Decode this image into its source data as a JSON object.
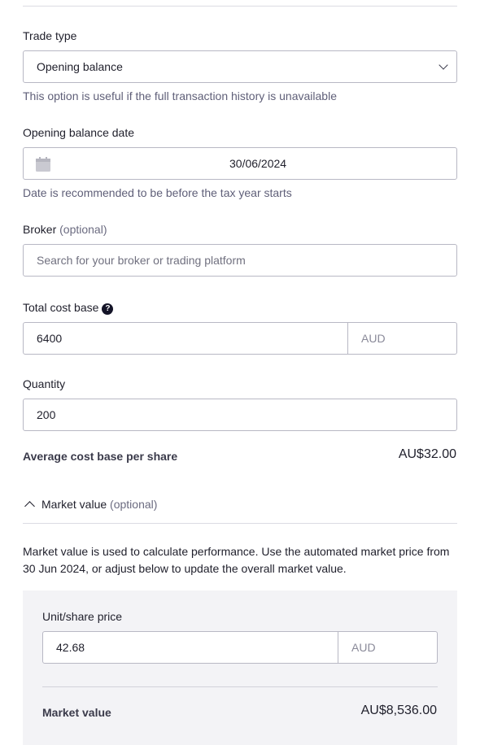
{
  "trade_type": {
    "label": "Trade type",
    "selected": "Opening balance",
    "hint": "This option is useful if the full transaction history is unavailable"
  },
  "opening_date": {
    "label": "Opening balance date",
    "value": "30/06/2024",
    "hint": "Date is recommended to be before the tax year starts"
  },
  "broker": {
    "label": "Broker",
    "optional": "(optional)",
    "placeholder": "Search for your broker or trading platform"
  },
  "total_cost": {
    "label": "Total cost base",
    "value": "6400",
    "currency": "AUD"
  },
  "quantity": {
    "label": "Quantity",
    "value": "200"
  },
  "average_cost": {
    "label": "Average cost base per share",
    "value": "AU$32.00"
  },
  "market_value_section": {
    "toggle_label": "Market value",
    "optional": "(optional)",
    "description": "Market value is used to calculate performance. Use the automated market price from 30 Jun 2024, or adjust below to update the overall market value.",
    "unit_price_label": "Unit/share price",
    "unit_price_value": "42.68",
    "unit_price_currency": "AUD",
    "market_value_label": "Market value",
    "market_value": "AU$8,536.00"
  },
  "icons": {
    "select": "chevron-down-icon",
    "date": "calendar-icon",
    "help": "question-circle-icon",
    "collapse": "chevron-up-icon"
  }
}
